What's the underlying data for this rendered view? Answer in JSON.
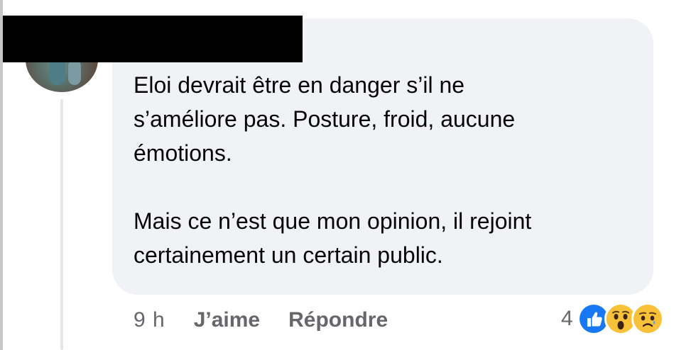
{
  "comment": {
    "paragraphs": [
      "Eloi devrait être en danger s’il ne\ns’améliore pas. Posture, froid, aucune\némotions.",
      "Mais ce n’est que mon opinion, il rejoint\ncertainement un certain public."
    ]
  },
  "actions": {
    "timestamp": "9 h",
    "like_label": "J’aime",
    "reply_label": "Répondre"
  },
  "reactions": {
    "count": "4",
    "icons": [
      "like-icon",
      "wow-icon",
      "sad-icon"
    ]
  },
  "colors": {
    "bubble": "#f0f2f5",
    "like_blue": "#1877f2",
    "emoji_yellow": "#f7c13a",
    "secondary_text": "#65676b"
  }
}
